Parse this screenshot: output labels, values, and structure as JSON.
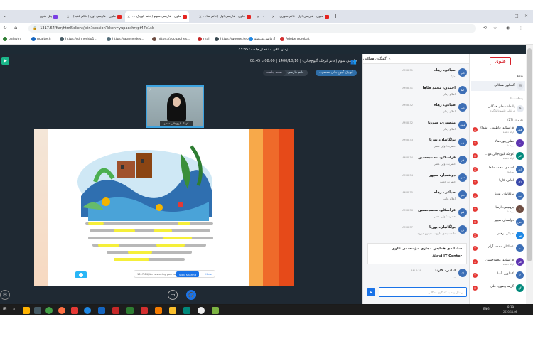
{
  "browser": {
    "tabs": [
      {
        "title": "پنل منون",
        "active": false
      },
      {
        "title": "ملون - فارسی اول (حاکم غنجا) -",
        "active": false
      },
      {
        "title": "ملون - فارسی سوم (خانم کوچک گیوچ... ",
        "active": true
      },
      {
        "title": "ملون - فارسی اول (خانم سا...",
        "active": false
      },
      {
        "title": "ملون - فارسی دوم (خانم رضائی...",
        "active": false
      },
      {
        "title": "ملون - فارسی اول (خانم ملوری) -",
        "active": false
      }
    ],
    "new_tab": "+",
    "url": "1317.64/Kar/html5client/join?sessionToken=yupacxhrypt47e1sk",
    "bookmarks": [
      {
        "label": "palavin",
        "color": "#2e7d32"
      },
      {
        "label": "ncaltech",
        "color": "#1565c0"
      },
      {
        "label": "https://sinneddu1...",
        "color": "#455a64"
      },
      {
        "label": "https://appserdev...",
        "color": "#546e7a"
      },
      {
        "label": "https://accuaghes...",
        "color": "#6d4c41"
      },
      {
        "label": "mail",
        "color": "#c62828"
      },
      {
        "label": "https://googe.teb...",
        "color": "#37474f"
      },
      {
        "label": "آزمایش وب‌ملو",
        "color": "#1e88e5"
      },
      {
        "label": "Adobe Acrobat",
        "color": "#d32f2f"
      }
    ]
  },
  "topbar": {
    "text": "زمان باقی مانده از جلسه: 23:35"
  },
  "stage": {
    "title": "فارسی سوم (خانم کوچک گیوچ‌جالی) | 1400/10/16 | 08:00 تا 08:45",
    "pills": [
      "کوچک گیوچ‌جالی معصو...",
      "خانم فارسی ...",
      "ضبط جلسه"
    ],
    "webcam_name": "کوچک گیوچ‌جالی معصو",
    "share_text": "1317.64/Kar is sharing your screen",
    "stop_label": "Stop sharing",
    "hide_label": "Hide"
  },
  "chat": {
    "title": "گفتگوی همگانی",
    "messages": [
      {
        "name": "صبائی، رهام",
        "time": "8:31 AM",
        "text": "علیک",
        "av": "صر"
      },
      {
        "name": "احمدی، محمد طاها",
        "time": "8:31 AM",
        "text": "اعلام زمان",
        "av": "اط"
      },
      {
        "name": "صبائی، رهام",
        "time": "8:32 AM",
        "text": "اعلام زمان",
        "av": "صر"
      },
      {
        "name": "منصوری، سورنا",
        "time": "8:32 AM",
        "text": "اعلام زمان",
        "av": "مس"
      },
      {
        "name": "بولگانیان، یوریا",
        "time": "8:33 AM",
        "text": "حضرت: ولی عصر",
        "av": "بی"
      },
      {
        "name": "قراسکلو، محمدحسین",
        "time": "8:34 AM",
        "text": "حضرت: ولی عصر",
        "av": "قم"
      },
      {
        "name": "دولتمدار، سپهر",
        "time": "8:34 AM",
        "text": "حضرت حجت",
        "av": "دس"
      },
      {
        "name": "صبائی، رهام",
        "time": "8:35 AM",
        "text": "اعلام غایب",
        "av": "صر"
      },
      {
        "name": "قراسکلو، محمدحسین",
        "time": "8:36 AM",
        "text": "حضرت: ولی عصر",
        "av": "قم"
      },
      {
        "name": "بولگانیان، یوریا",
        "time": "8:37 AM",
        "text": "ما دستبندی مارو نه نمیتوم میرود",
        "av": "بی"
      }
    ],
    "notice_line1": "سامانه‌ی همایش مجازی مؤسسه‌ی علوی",
    "notice_line2": "Alavi IT Center",
    "last_message": {
      "name": "امانی، کارنا",
      "time": "8:38 AM",
      "text": "...",
      "av": "اک"
    },
    "input_placeholder": "ارسال پیام به گفتگوی همگانی",
    "send_icon": "send-icon"
  },
  "sidebar": {
    "brand": "علوی",
    "messages_section": "پیام‌ها",
    "public_chat": "گفتگوی همگانی",
    "notes_section": "یادداشت‌ها",
    "shared_notes": "یادداشت‌های همگانی",
    "shared_notes_sub": "در قالب جلسه تا یادگیری",
    "users_section": "کاربران (27)",
    "participants": [
      {
        "name": "قراسکلو، فاطمه... (شما)",
        "sub": "ارائه دهنده",
        "av": "قف"
      },
      {
        "name": "نظیری‌پور، هالا",
        "sub": "بی‌صدا",
        "av": "نه"
      },
      {
        "name": "کوچک گیوچ‌جالی مع...",
        "sub": "ارائه دهنده",
        "av": "کم"
      },
      {
        "name": "احمدی، محمد طاها",
        "sub": "بی‌صدا",
        "av": "اط"
      },
      {
        "name": "امانی، کارنا",
        "sub": "",
        "av": "اک"
      },
      {
        "name": "بولگانیان، یوریا",
        "sub": "",
        "av": "بی"
      },
      {
        "name": "بروتیمی، ارمیا",
        "sub": "بی‌صدا",
        "av": "با"
      },
      {
        "name": "دولتمدار، سپهر",
        "sub": "",
        "av": "دس"
      },
      {
        "name": "صبائی، رهام",
        "sub": "",
        "av": "صر"
      },
      {
        "name": "عطائیان محمد، آرام",
        "sub": "",
        "av": "عآ"
      },
      {
        "name": "قراسکلو، محمدحسین",
        "sub": "ارائه دهنده",
        "av": "قم"
      },
      {
        "name": "کشاورز، آنیتا",
        "sub": "",
        "av": "کآ"
      },
      {
        "name": "گزینه رضوی، علی",
        "sub": "",
        "av": "گع"
      }
    ]
  },
  "taskbar": {
    "lang": "ENG",
    "time": "8:39",
    "date": "2020-11-06"
  }
}
